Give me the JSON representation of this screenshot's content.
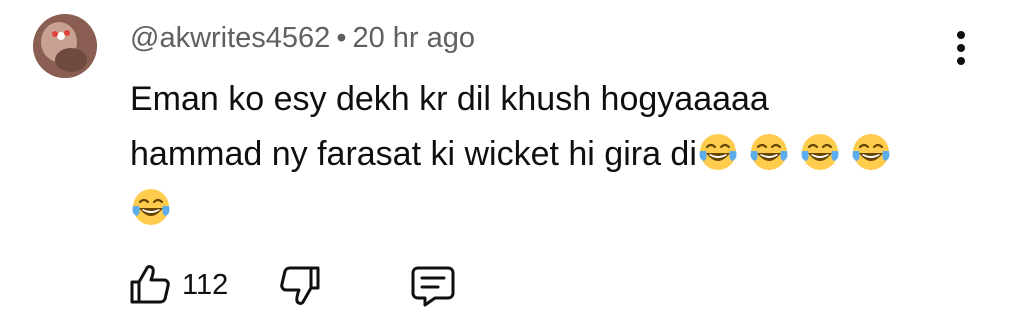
{
  "comment": {
    "author": "@akwrites4562",
    "separator": "•",
    "time": "20 hr ago",
    "line1": "Eman ko esy dekh kr dil khush hogyaaaaa",
    "line2": "hammad ny farasat ki wicket hi gira di",
    "emoji_icon": "face-with-tears-of-joy-icon",
    "emoji_count": 5,
    "like_count": "112"
  },
  "icons": {
    "menu": "more-vertical-icon",
    "like": "thumbs-up-icon",
    "dislike": "thumbs-down-icon",
    "reply": "comment-reply-icon"
  },
  "colors": {
    "text": "#0f0f0f",
    "meta": "#606060",
    "emoji_face": "#FFCC4D",
    "emoji_tear": "#5DADEC"
  }
}
